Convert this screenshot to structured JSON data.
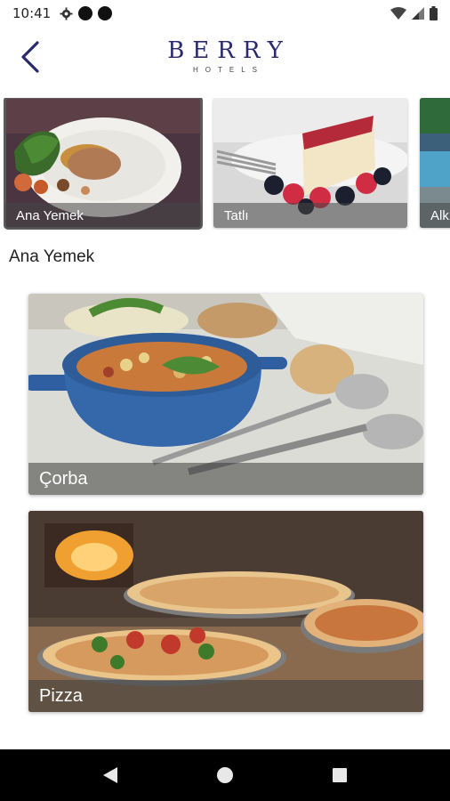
{
  "status_bar": {
    "time": "10:41"
  },
  "header": {
    "brand_name": "BERRY",
    "brand_sub": "HOTELS"
  },
  "categories": [
    {
      "label": "Ana Yemek",
      "selected": true
    },
    {
      "label": "Tatlı",
      "selected": false
    },
    {
      "label": "Alk",
      "selected": false
    }
  ],
  "section": {
    "title": "Ana Yemek"
  },
  "menu_items": [
    {
      "label": "Çorba"
    },
    {
      "label": "Pizza"
    }
  ],
  "colors": {
    "brand": "#2a2a6e",
    "nav_bar": "#000000"
  }
}
